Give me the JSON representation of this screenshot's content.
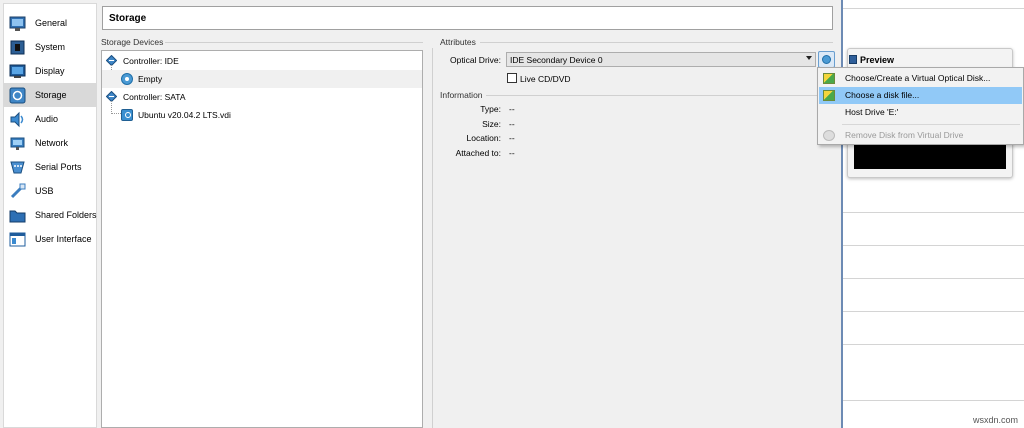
{
  "nav": {
    "items": [
      {
        "label": "General"
      },
      {
        "label": "System"
      },
      {
        "label": "Display"
      },
      {
        "label": "Storage"
      },
      {
        "label": "Audio"
      },
      {
        "label": "Network"
      },
      {
        "label": "Serial Ports"
      },
      {
        "label": "USB"
      },
      {
        "label": "Shared Folders"
      },
      {
        "label": "User Interface"
      }
    ],
    "selected": "Storage"
  },
  "header": {
    "title": "Storage"
  },
  "storage_devices": {
    "group_title": "Storage Devices",
    "tree": [
      {
        "label": "Controller: IDE"
      },
      {
        "label": "Empty"
      },
      {
        "label": "Controller: SATA"
      },
      {
        "label": "Ubuntu v20.04.2 LTS.vdi"
      }
    ]
  },
  "attributes": {
    "group_title": "Attributes",
    "optical_drive_label": "Optical Drive:",
    "optical_drive_value": "IDE Secondary Device 0",
    "live_cd_label": "Live CD/DVD",
    "live_cd_checked": false
  },
  "information": {
    "group_title": "Information",
    "rows": [
      {
        "label": "Type:",
        "value": "--"
      },
      {
        "label": "Size:",
        "value": "--"
      },
      {
        "label": "Location:",
        "value": "--"
      },
      {
        "label": "Attached to:",
        "value": "--"
      }
    ]
  },
  "menu": {
    "items": [
      {
        "label": "Choose/Create a Virtual Optical Disk..."
      },
      {
        "label": "Choose a disk file..."
      },
      {
        "label": "Host Drive 'E:'"
      },
      {
        "label": "Remove Disk from Virtual Drive"
      }
    ],
    "highlight_color": "#91c9f7"
  },
  "preview": {
    "title": "Preview"
  },
  "watermark": "wsxdn.com"
}
